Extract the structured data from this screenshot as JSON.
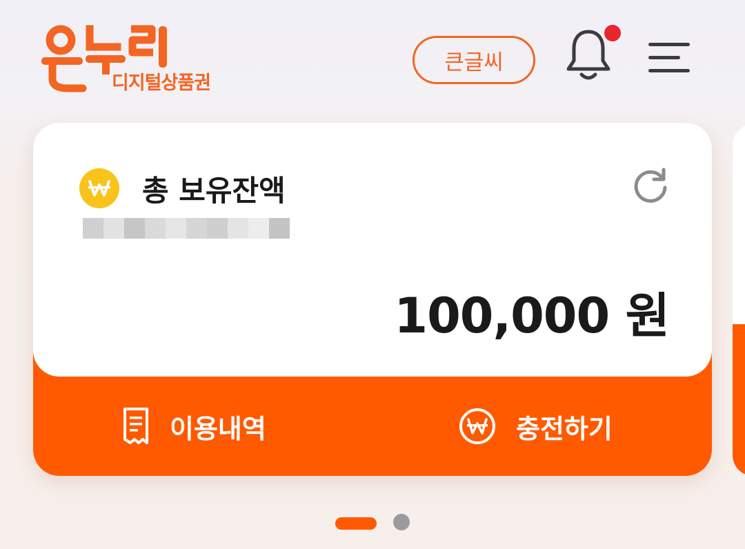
{
  "header": {
    "logo_text": "온누리",
    "logo_subtitle": "디지털상품권",
    "big_font_label": "큰글씨",
    "has_notification": true
  },
  "balance_card": {
    "title": "총 보유잔액",
    "amount": "100,000 원",
    "history_label": "이용내역",
    "charge_label": "충전하기"
  },
  "pager": {
    "current": 1,
    "total": 2
  },
  "colors": {
    "brand_orange": "#ff5a00",
    "logo_orange": "#f26522",
    "coin_yellow": "#f9c31a",
    "notification_red": "#e8262c"
  },
  "icons": {
    "logo": "onnuri-logo",
    "notification": "bell-icon",
    "menu": "hamburger-menu-icon",
    "refresh": "refresh-icon",
    "balance": "won-coin-icon",
    "history": "receipt-icon",
    "charge": "won-circle-icon"
  }
}
